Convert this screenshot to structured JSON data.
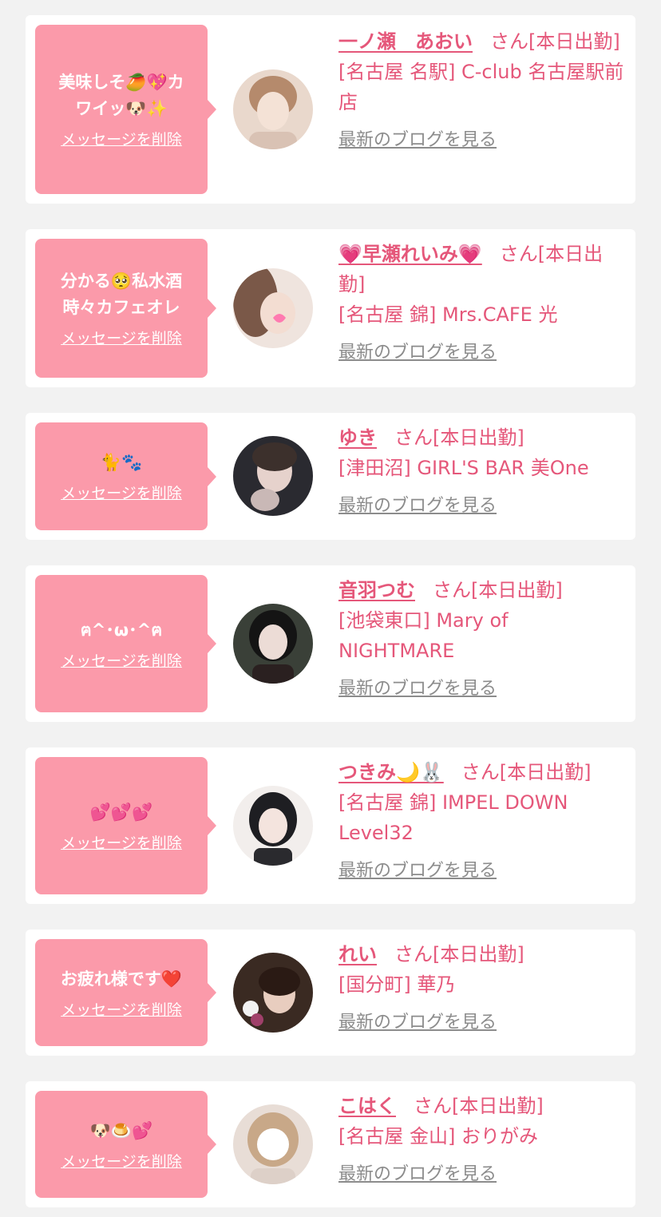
{
  "cards": [
    {
      "message": "美味しそ🥭💖カ\nワイッ🐶✨",
      "delete_label": "メッセージを削除",
      "name": "一ノ瀬　あおい",
      "suffix": "さん[本日出勤]",
      "shop": "[名古屋 名駅] C-club 名古屋駅前店",
      "blog_label": "最新のブログを見る",
      "avatar_colors": [
        "#e9d8cc",
        "#b58a6c"
      ]
    },
    {
      "message": "分かる🥺私水酒\n時々カフェオレ",
      "delete_label": "メッセージを削除",
      "name": "💗早瀬れいみ💗",
      "suffix": "さん[本日出勤]",
      "shop": "[名古屋 錦] Mrs.CAFE 光",
      "blog_label": "最新のブログを見る",
      "avatar_colors": [
        "#efe4de",
        "#7a5848"
      ]
    },
    {
      "message": "🐈🐾",
      "delete_label": "メッセージを削除",
      "name": "ゆき",
      "suffix": "さん[本日出勤]",
      "shop": "[津田沼] GIRL'S BAR 美One",
      "blog_label": "最新のブログを見る",
      "avatar_colors": [
        "#2a2a30",
        "#c9b8b6"
      ]
    },
    {
      "message": "ฅ^･ω･^ฅ",
      "delete_label": "メッセージを削除",
      "name": "音羽つむ",
      "suffix": "さん[本日出勤]",
      "shop": "[池袋東口] Mary of NIGHTMARE",
      "blog_label": "最新のブログを見る",
      "avatar_colors": [
        "#3a4038",
        "#d9c8c4"
      ]
    },
    {
      "message": "💕💕💕",
      "delete_label": "メッセージを削除",
      "name": "つきみ🌙🐰",
      "suffix": "さん[本日出勤]",
      "shop": "[名古屋 錦] IMPEL DOWN Level32",
      "blog_label": "最新のブログを見る",
      "avatar_colors": [
        "#f2eeec",
        "#1e1e22"
      ]
    },
    {
      "message": "お疲れ様です❤️",
      "delete_label": "メッセージを削除",
      "name": "れい",
      "suffix": "さん[本日出勤]",
      "shop": "[国分町] 華乃",
      "blog_label": "最新のブログを見る",
      "avatar_colors": [
        "#3a2a22",
        "#d8b8a4"
      ]
    },
    {
      "message": "🐶🍮💕",
      "delete_label": "メッセージを削除",
      "name": "こはく",
      "suffix": "さん[本日出勤]",
      "shop": "[名古屋 金山] おりがみ",
      "blog_label": "最新のブログを見る",
      "avatar_colors": [
        "#e8ddd6",
        "#c8a888"
      ]
    }
  ]
}
